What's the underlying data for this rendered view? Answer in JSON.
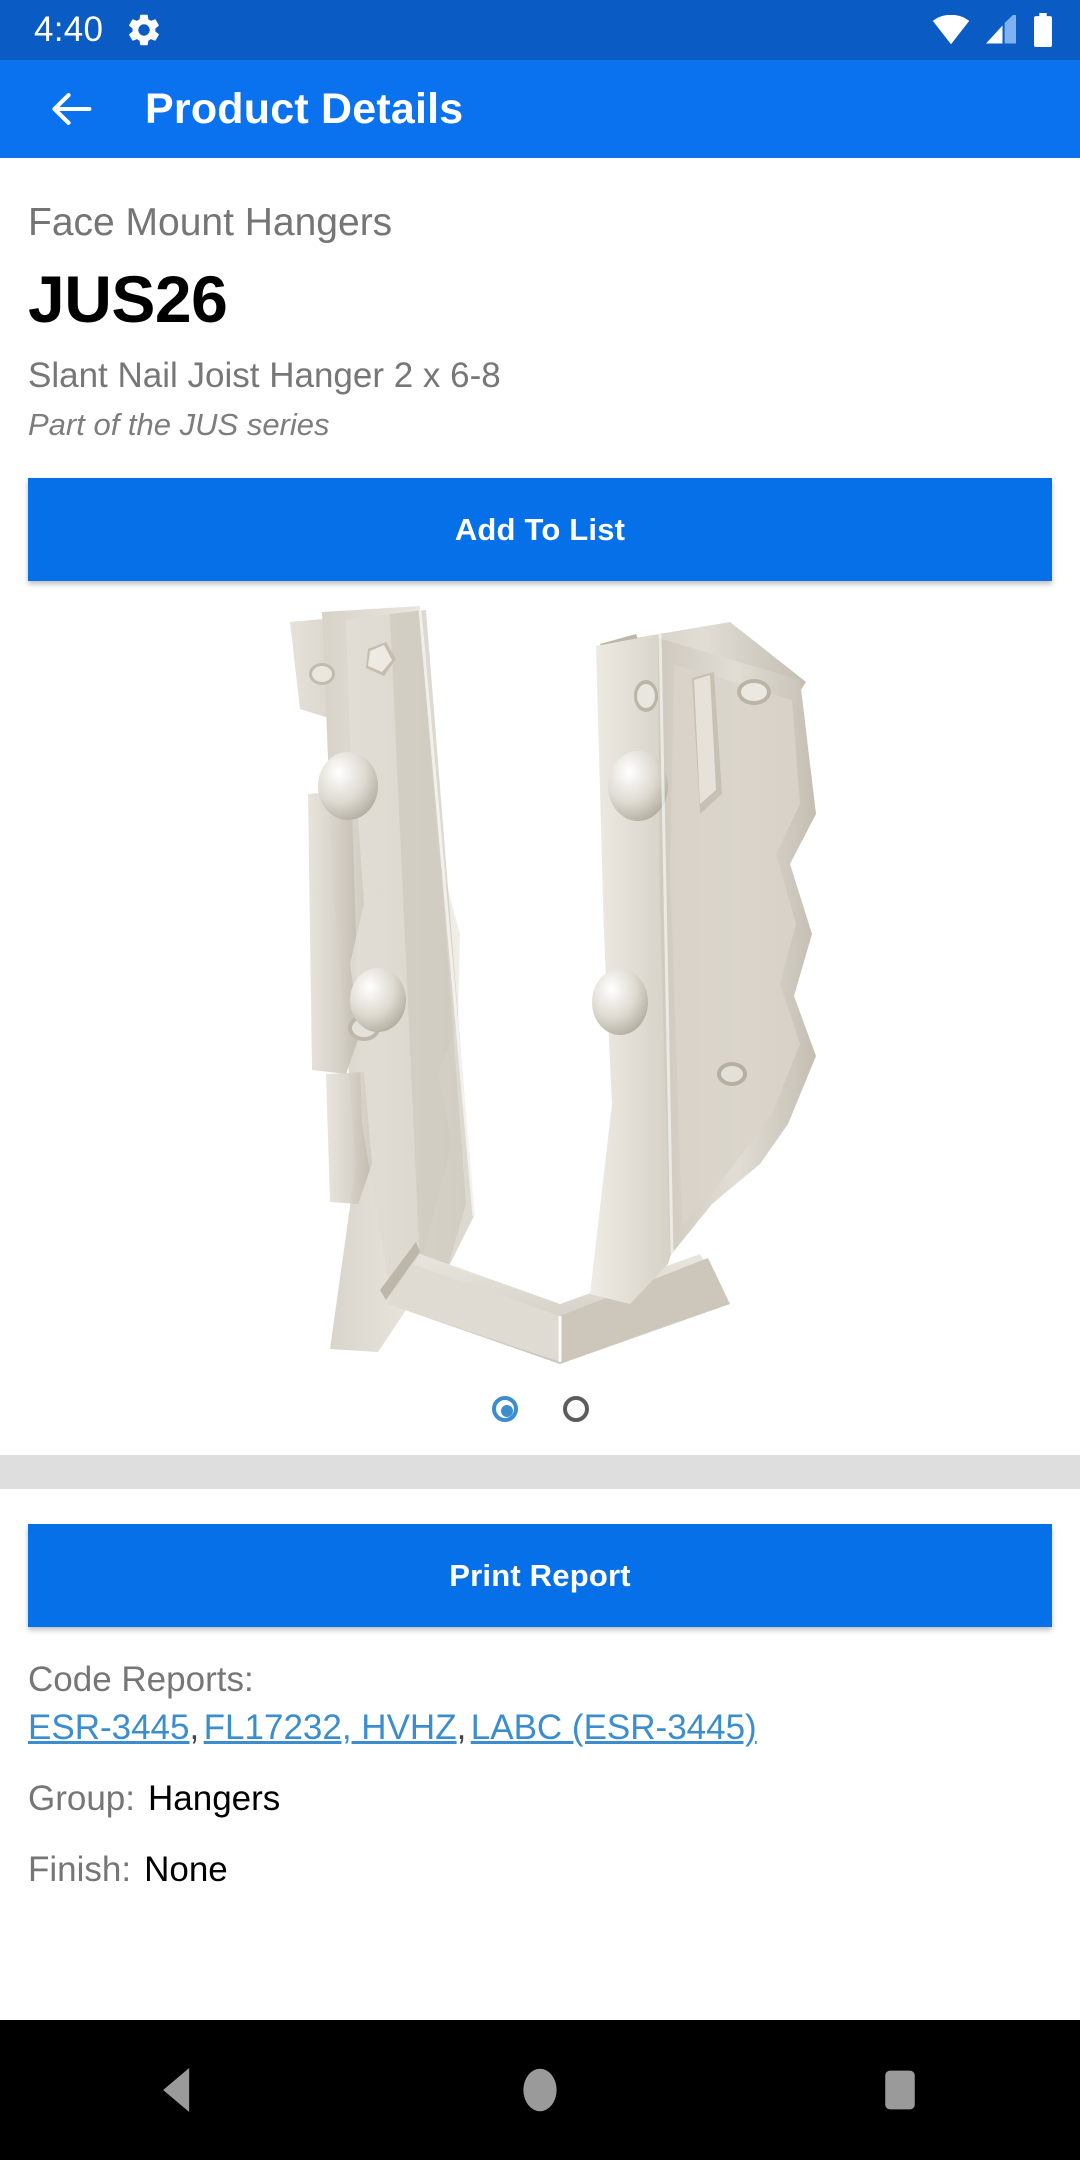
{
  "status_bar": {
    "time": "4:40",
    "icons": [
      "gear-icon",
      "wifi-icon",
      "cellular-signal-icon",
      "battery-icon"
    ],
    "background": "#0B5BC4"
  },
  "app_bar": {
    "title": "Product Details",
    "back_icon": "back-arrow-icon",
    "background": "#0A72EE"
  },
  "product": {
    "category": "Face Mount Hangers",
    "model": "JUS26",
    "subtitle": "Slant Nail Joist Hanger 2 x 6-8",
    "series_note": "Part of the JUS series",
    "image_alt": "galvanized-steel-joist-hanger"
  },
  "actions": {
    "add_to_list_label": "Add To List",
    "print_report_label": "Print Report",
    "button_color": "#0670E8"
  },
  "carousel": {
    "total_pages": 2,
    "active_index": 0,
    "active_color": "#3C8DCE",
    "inactive_color": "#5C5C5C"
  },
  "specs": {
    "code_reports_label": "Code Reports:",
    "code_report_links": [
      "ESR-3445",
      "FL17232, HVHZ",
      "LABC (ESR-3445)"
    ],
    "separator": ",",
    "link_color": "#3C8DCE",
    "rows": [
      {
        "label": "Group:",
        "value": "Hangers"
      },
      {
        "label": "Finish:",
        "value": "None"
      }
    ]
  },
  "nav_bar": {
    "background": "#000000",
    "icon_color": "#9A9A9A",
    "buttons": [
      {
        "name": "back",
        "icon": "triangle-back-icon"
      },
      {
        "name": "home",
        "icon": "circle-home-icon"
      },
      {
        "name": "recents",
        "icon": "square-recents-icon"
      }
    ]
  }
}
